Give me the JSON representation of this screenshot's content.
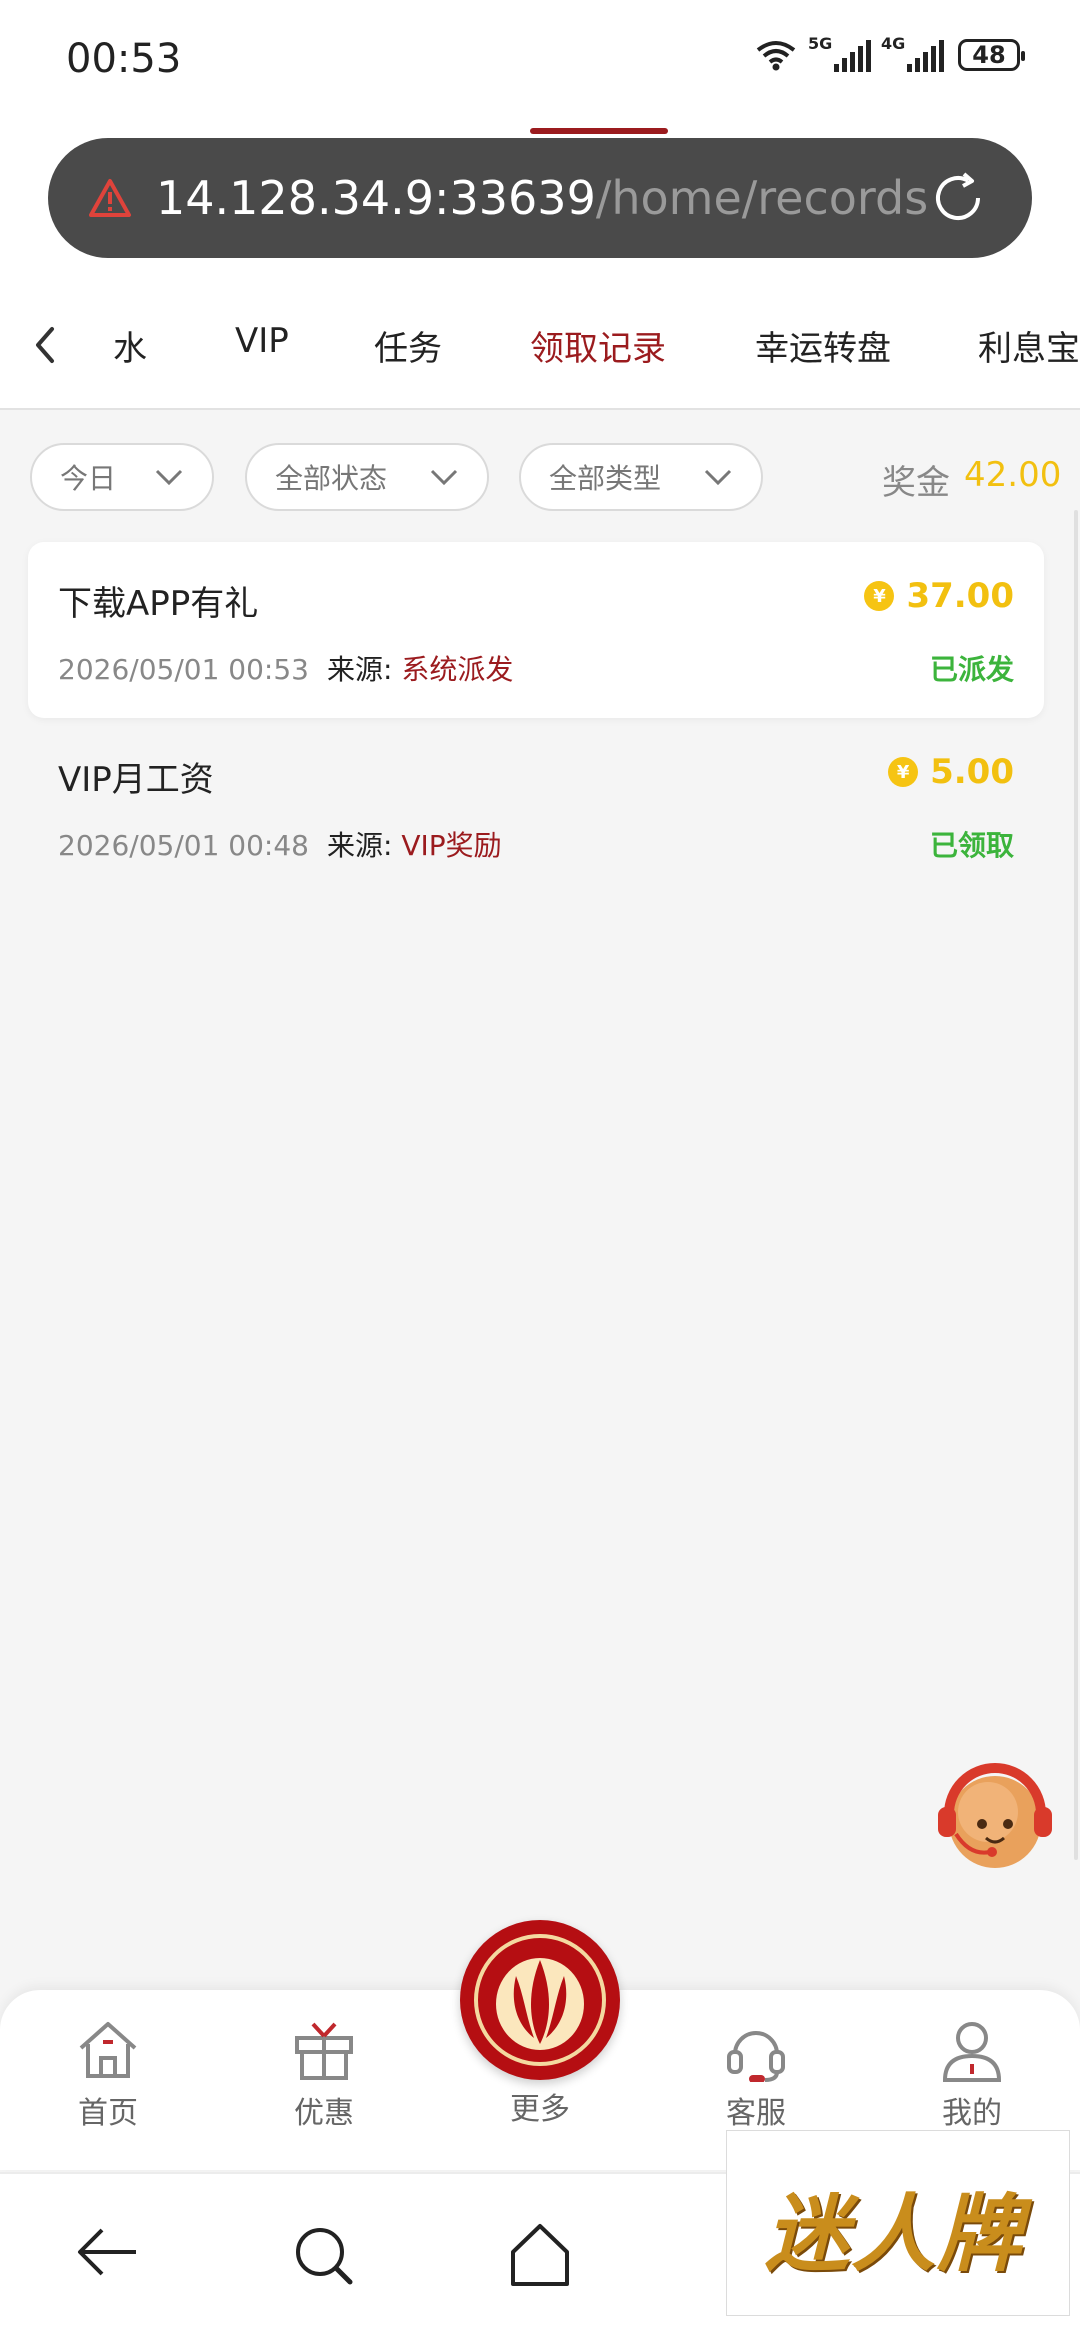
{
  "status_bar": {
    "time": "00:53",
    "net1": "5G",
    "net2": "4G",
    "battery": "48"
  },
  "browser": {
    "url_host": "14.128.34.9:33639",
    "url_path": "/home/records"
  },
  "tabs": [
    {
      "label": "水",
      "active": false
    },
    {
      "label": "VIP",
      "active": false
    },
    {
      "label": "任务",
      "active": false
    },
    {
      "label": "领取记录",
      "active": true
    },
    {
      "label": "幸运转盘",
      "active": false
    },
    {
      "label": "利息宝",
      "active": false
    }
  ],
  "filters": {
    "date": "今日",
    "status": "全部状态",
    "type": "全部类型",
    "bonus_label": "奖金",
    "bonus_value": "42.00"
  },
  "records": [
    {
      "title": "下载APP有礼",
      "amount": "37.00",
      "datetime": "2026/05/01 00:53",
      "source_label": "来源:",
      "source": "系统派发",
      "status": "已派发"
    },
    {
      "title": "VIP月工资",
      "amount": "5.00",
      "datetime": "2026/05/01 00:48",
      "source_label": "来源:",
      "source": "VIP奖励",
      "status": "已领取"
    }
  ],
  "coin_symbol": "¥",
  "bottom_nav": [
    {
      "label": "首页",
      "icon": "home-icon"
    },
    {
      "label": "优惠",
      "icon": "gift-icon"
    },
    {
      "label": "更多",
      "icon": "brand-logo-icon"
    },
    {
      "label": "客服",
      "icon": "headset-icon"
    },
    {
      "label": "我的",
      "icon": "user-icon"
    }
  ],
  "watermark": "迷人牌",
  "colors": {
    "accent": "#9b1b1e",
    "gold": "#f2c010",
    "success": "#3cb43c",
    "url_bar_bg": "#4a4a4a"
  }
}
